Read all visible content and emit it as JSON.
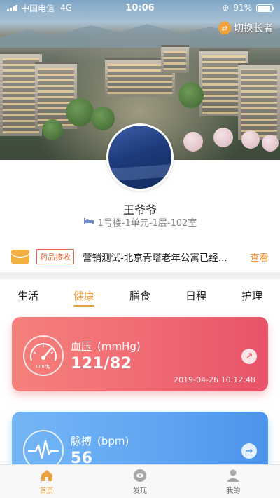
{
  "status_bar": {
    "carrier": "中国电信",
    "network": "4G",
    "time": "10:06",
    "battery_percent": "91%",
    "battery_level": 0.91
  },
  "header": {
    "switch_elder_label": "切换长者"
  },
  "profile": {
    "name": "王爷爷",
    "room": "1号楼-1单元-1层-102室",
    "bed_icon": "bed-icon"
  },
  "notice": {
    "tag": "药品接收",
    "text": "营销测试-北京青塔老年公寓已经...",
    "action": "查看",
    "icon": "mail-icon"
  },
  "tabs": [
    {
      "label": "生活",
      "active": false
    },
    {
      "label": "健康",
      "active": true
    },
    {
      "label": "膳食",
      "active": false
    },
    {
      "label": "日程",
      "active": false
    },
    {
      "label": "护理",
      "active": false
    }
  ],
  "cards": {
    "blood_pressure": {
      "title": "血压",
      "unit": "(mmHg)",
      "gauge_text": "mmHg",
      "value": "121/82",
      "timestamp": "2019-04-26 10:12:48",
      "color": "#f06c74"
    },
    "pulse": {
      "title": "脉搏",
      "unit": "(bpm)",
      "value": "56",
      "color": "#5fa4f1"
    }
  },
  "nav": [
    {
      "label": "首页",
      "icon": "home-icon",
      "active": true
    },
    {
      "label": "发现",
      "icon": "discover-icon",
      "active": false
    },
    {
      "label": "我的",
      "icon": "user-icon",
      "active": false
    }
  ],
  "accent_color": "#e9a042"
}
